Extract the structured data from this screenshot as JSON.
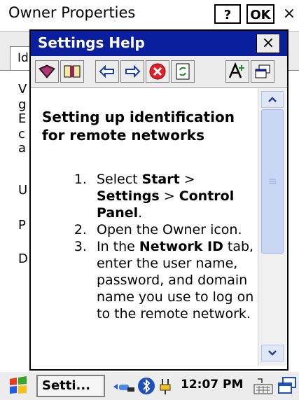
{
  "owner_window": {
    "title": "Owner Properties",
    "help_button": "?",
    "ok_button": "OK",
    "close_button": "×",
    "tab_label": "Id"
  },
  "help_dialog": {
    "title": "Settings Help",
    "close_button": "×",
    "toolbar": [
      "contents-book-icon",
      "open-book-icon",
      "back-arrow-icon",
      "forward-arrow-icon",
      "stop-icon",
      "refresh-icon",
      "font-size-icon",
      "window-icon"
    ],
    "heading": "Setting up identification for remote networks",
    "steps": [
      {
        "parts": [
          "Select ",
          "Start",
          " > ",
          "Settings",
          " > ",
          "Control Panel",
          "."
        ]
      },
      {
        "text": "Open the Owner icon."
      },
      {
        "parts": [
          "In the ",
          "Network ID",
          " tab, enter the user name, password, and domain name you use to log on to the remote network."
        ]
      }
    ]
  },
  "taskbar": {
    "start_icon": "windows-flag-icon",
    "task_label": "Setti...",
    "clock": "12:07 PM",
    "tray_icons": [
      "network-icon",
      "bluetooth-icon",
      "power-icon",
      "keyboard-icon",
      "desktop-icon"
    ]
  },
  "colors": {
    "title_bar": "#0a1f9e",
    "window_bg": "#ececec"
  }
}
